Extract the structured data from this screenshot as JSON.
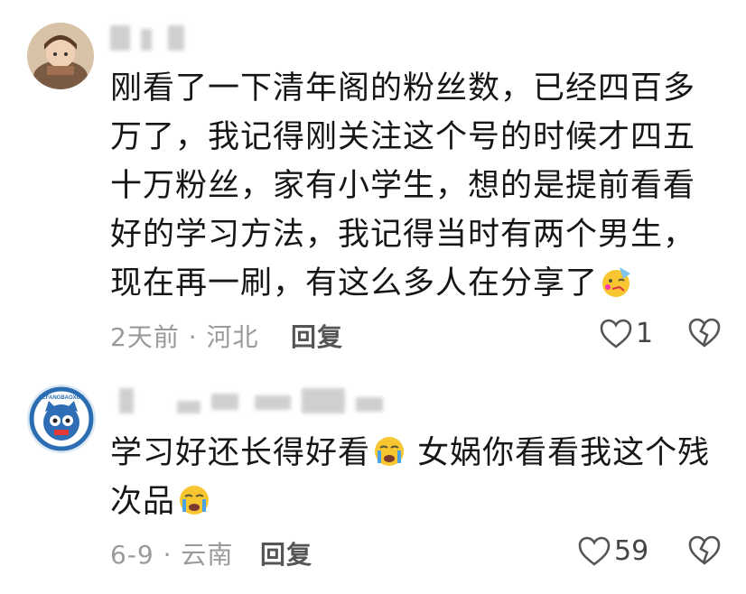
{
  "comments": [
    {
      "text": "刚看了一下清年阁的粉丝数，已经四百多万了，我记得刚关注这个号的时候才四五十万粉丝，家有小学生，想的是提前看看好的学习方法，我记得当时有两个男生，现在再一刷，有这么多人在分享了",
      "emoji": "party-face-emoji",
      "meta": "2天前 · 河北",
      "reply_label": "回复",
      "like_count": "1"
    },
    {
      "text_part1": "学习好还长得好看",
      "emoji1": "crying-face-emoji",
      "text_part2": " 女娲你看看我这个残次品",
      "emoji2": "crying-face-emoji",
      "meta": "6-9 · 云南",
      "reply_label": "回复",
      "like_count": "59",
      "avatar_text": "LEFANGBAOXUE"
    }
  ],
  "colors": {
    "text": "#161616",
    "meta": "#9a9a9a",
    "icon": "#555555"
  }
}
